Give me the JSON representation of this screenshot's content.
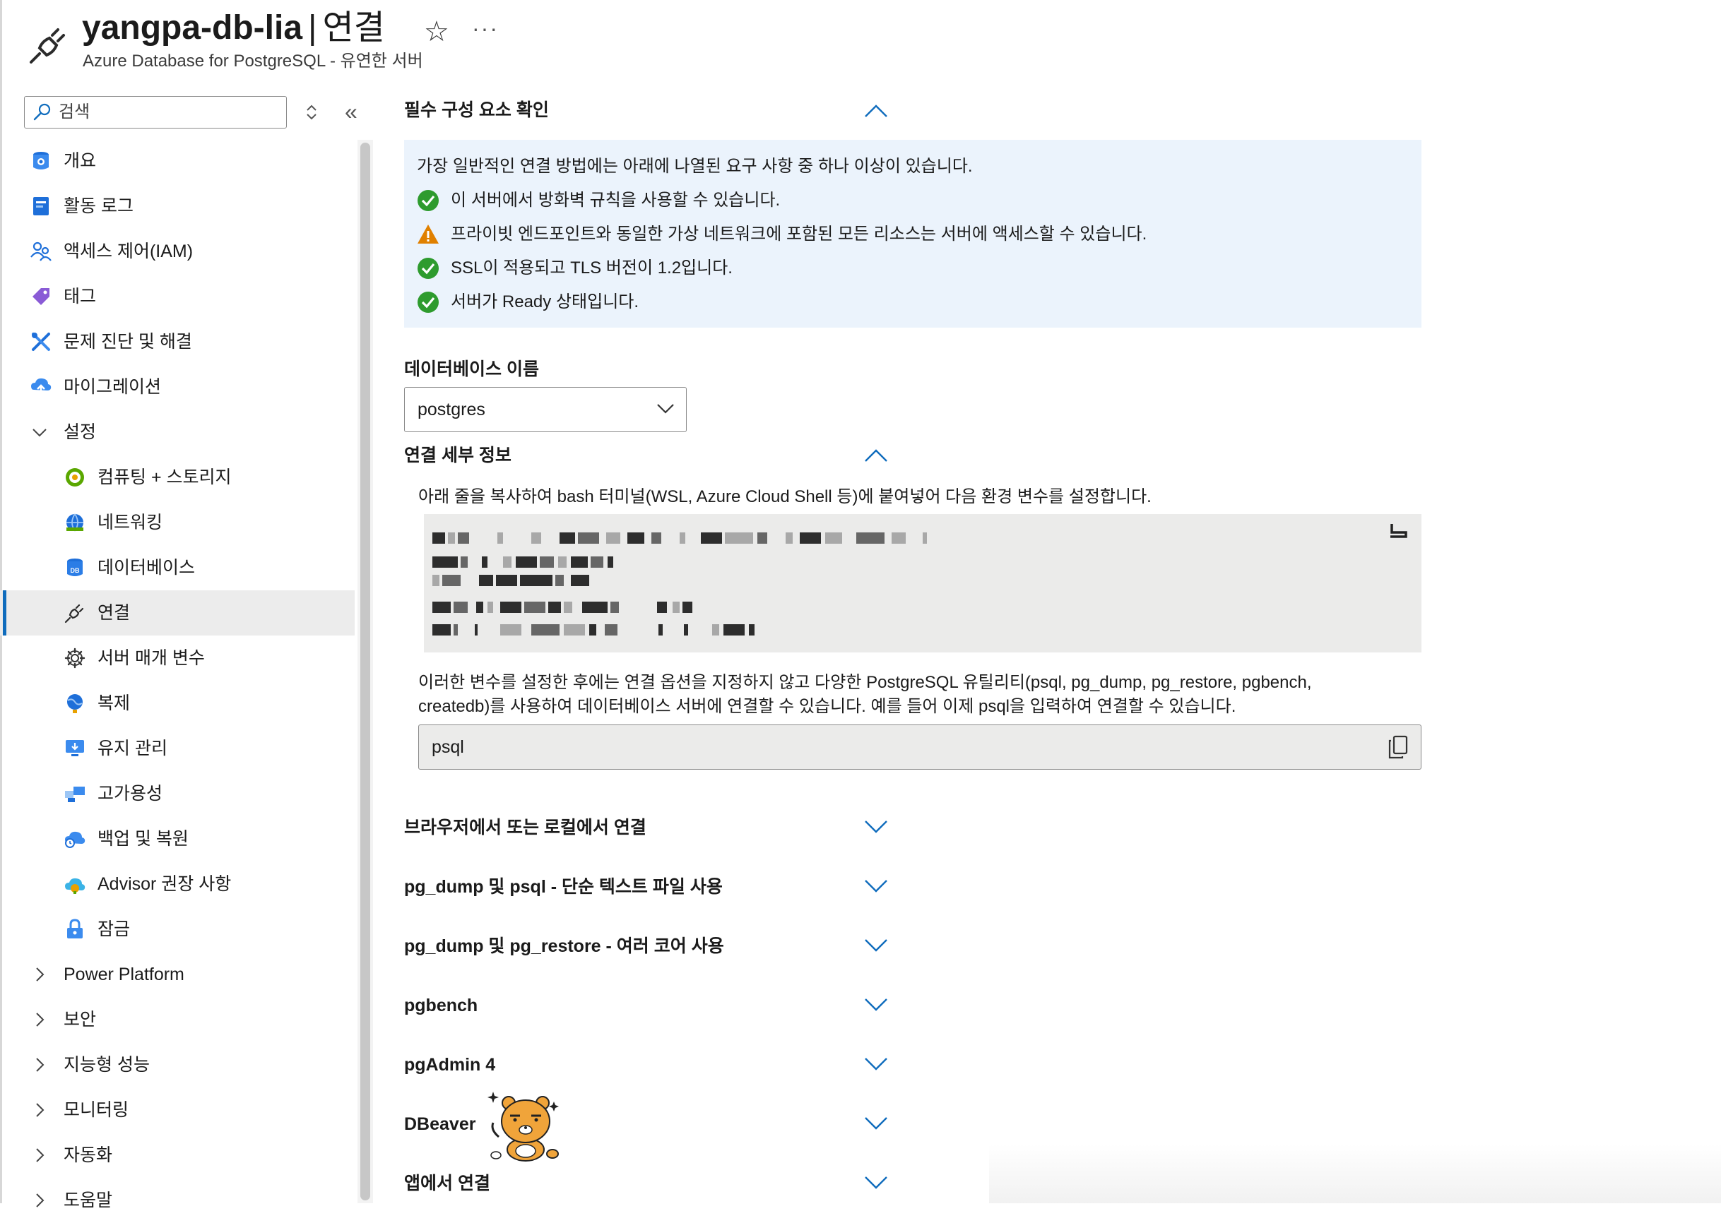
{
  "header": {
    "resource_name": "yangpa-db-lia",
    "separator": "|",
    "page_name": "연결",
    "subtitle": "Azure Database for PostgreSQL - 유연한 서버",
    "more_label": "···"
  },
  "sidebar": {
    "search_placeholder": "검색",
    "collapse_label": "«",
    "items": [
      {
        "label": "개요",
        "icon": "overview-icon"
      },
      {
        "label": "활동 로그",
        "icon": "activity-log-icon"
      },
      {
        "label": "액세스 제어(IAM)",
        "icon": "iam-icon"
      },
      {
        "label": "태그",
        "icon": "tag-icon"
      },
      {
        "label": "문제 진단 및 해결",
        "icon": "diagnose-icon"
      },
      {
        "label": "마이그레이션",
        "icon": "migration-icon"
      },
      {
        "label": "설정",
        "icon": "chevron-down-icon"
      },
      {
        "label": "컴퓨팅 + 스토리지",
        "icon": "compute-storage-icon"
      },
      {
        "label": "네트워킹",
        "icon": "networking-icon"
      },
      {
        "label": "데이터베이스",
        "icon": "database-icon"
      },
      {
        "label": "연결",
        "icon": "connect-icon"
      },
      {
        "label": "서버 매개 변수",
        "icon": "gear-icon"
      },
      {
        "label": "복제",
        "icon": "replication-icon"
      },
      {
        "label": "유지 관리",
        "icon": "maintenance-icon"
      },
      {
        "label": "고가용성",
        "icon": "high-availability-icon"
      },
      {
        "label": "백업 및 복원",
        "icon": "backup-icon"
      },
      {
        "label": "Advisor 권장 사항",
        "icon": "advisor-icon"
      },
      {
        "label": "잠금",
        "icon": "lock-icon"
      },
      {
        "label": "Power Platform",
        "icon": "chevron-right-icon"
      },
      {
        "label": "보안",
        "icon": "chevron-right-icon"
      },
      {
        "label": "지능형 성능",
        "icon": "chevron-right-icon"
      },
      {
        "label": "모니터링",
        "icon": "chevron-right-icon"
      },
      {
        "label": "자동화",
        "icon": "chevron-right-icon"
      },
      {
        "label": "도움말",
        "icon": "chevron-right-icon"
      }
    ],
    "active_item": "연결"
  },
  "prereq": {
    "title": "필수 구성 요소 확인",
    "intro": "가장 일반적인 연결 방법에는 아래에 나열된 요구 사항 중 하나 이상이 있습니다.",
    "checks": [
      {
        "status": "ok",
        "text": "이 서버에서 방화벽 규칙을 사용할 수 있습니다."
      },
      {
        "status": "warning",
        "text": "프라이빗 엔드포인트와 동일한 가상 네트워크에 포함된 모든 리소스는 서버에 액세스할 수 있습니다."
      },
      {
        "status": "ok",
        "text": "SSL이 적용되고 TLS 버전이 1.2입니다."
      },
      {
        "status": "ok",
        "text": "서버가 Ready 상태입니다."
      }
    ]
  },
  "database": {
    "label": "데이터베이스 이름",
    "selected": "postgres"
  },
  "connection_details": {
    "title": "연결 세부 정보",
    "description": "아래 줄을 복사하여 bash 터미널(WSL, Azure Cloud Shell 등)에 붙여넣어 다음 환경 변수를 설정합니다.",
    "after_text_line1": "이러한 변수를 설정한 후에는 연결 옵션을 지정하지 않고 다양한 PostgreSQL 유틸리티(psql, pg_dump, pg_restore, pgbench,",
    "after_text_line2": "createdb)를 사용하여 데이터베이스 서버에 연결할 수 있습니다. 예를 들어 이제 psql을 입력하여 연결할 수 있습니다.",
    "psql_command": "psql"
  },
  "accordions": [
    {
      "label": "브라우저에서 또는 로컬에서 연결"
    },
    {
      "label": "pg_dump 및 psql - 단순 텍스트 파일 사용"
    },
    {
      "label": "pg_dump 및 pg_restore - 여러 코어 사용"
    },
    {
      "label": "pgbench"
    },
    {
      "label": "pgAdmin 4"
    },
    {
      "label": "DBeaver"
    },
    {
      "label": "앱에서 연결"
    }
  ],
  "colors": {
    "accent": "#0f6cbd",
    "ok_green": "#2e9b2e",
    "warning_orange": "#e08000",
    "info_bg": "#ebf3fc",
    "code_bg": "#ebebea"
  }
}
